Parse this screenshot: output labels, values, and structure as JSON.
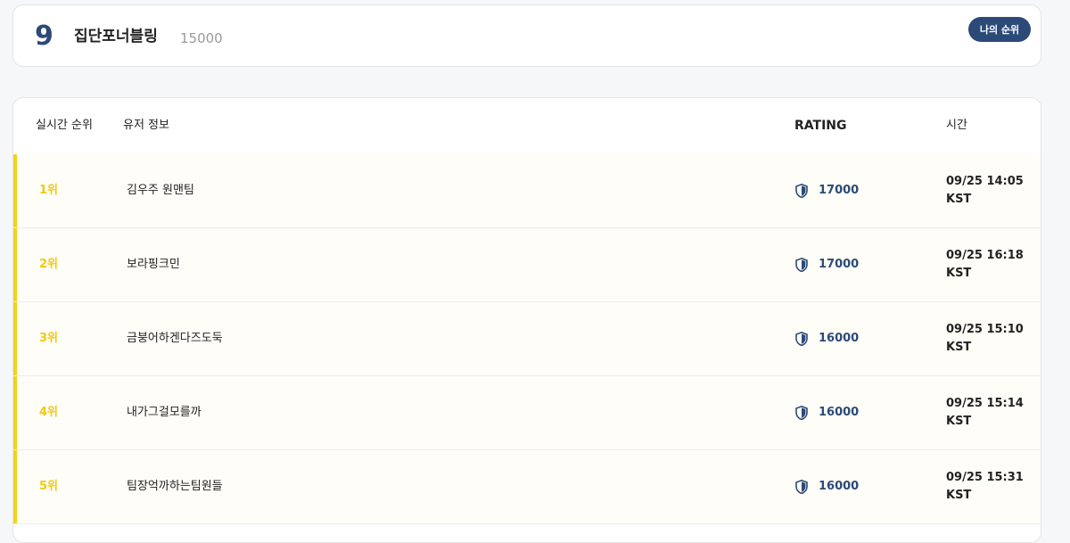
{
  "my_rank": {
    "rank": "9",
    "team_name": "집단포너블링",
    "rating": "15000",
    "button_label": "나의 순위"
  },
  "table": {
    "headers": {
      "rank": "실시간 순위",
      "user": "유저 정보",
      "rating": "RATING",
      "time": "시간"
    },
    "rows": [
      {
        "rank": "1위",
        "user": "김우주 원맨팀",
        "rating": "17000",
        "date": "09/25 14:05",
        "tz": "KST"
      },
      {
        "rank": "2위",
        "user": "보라핑크민",
        "rating": "17000",
        "date": "09/25 16:18",
        "tz": "KST"
      },
      {
        "rank": "3위",
        "user": "금붕어하겐다즈도둑",
        "rating": "16000",
        "date": "09/25 15:10",
        "tz": "KST"
      },
      {
        "rank": "4위",
        "user": "내가그걸모를까",
        "rating": "16000",
        "date": "09/25 15:14",
        "tz": "KST"
      },
      {
        "rank": "5위",
        "user": "팀장억까하는팀원들",
        "rating": "16000",
        "date": "09/25 15:31",
        "tz": "KST"
      }
    ]
  },
  "icons": {
    "rating": "shield-icon"
  },
  "colors": {
    "primary": "#2c4a78",
    "rank_gold": "#f2c811"
  }
}
